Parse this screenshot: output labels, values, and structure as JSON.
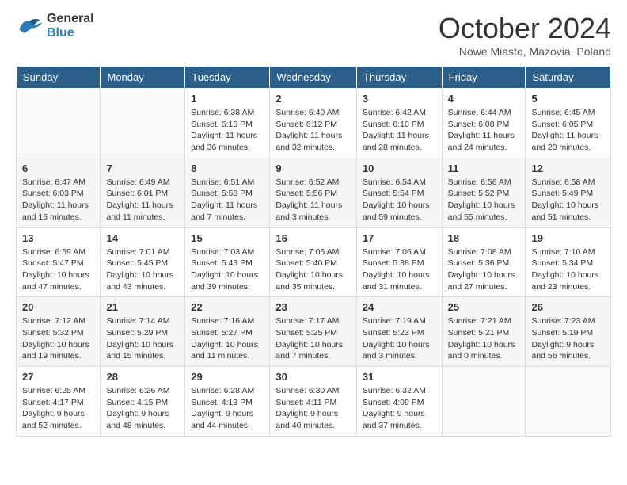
{
  "header": {
    "logo_general": "General",
    "logo_blue": "Blue",
    "month_title": "October 2024",
    "location": "Nowe Miasto, Mazovia, Poland"
  },
  "days_of_week": [
    "Sunday",
    "Monday",
    "Tuesday",
    "Wednesday",
    "Thursday",
    "Friday",
    "Saturday"
  ],
  "weeks": [
    {
      "days": [
        {
          "num": "",
          "info": ""
        },
        {
          "num": "",
          "info": ""
        },
        {
          "num": "1",
          "info": "Sunrise: 6:38 AM\nSunset: 6:15 PM\nDaylight: 11 hours and 36 minutes."
        },
        {
          "num": "2",
          "info": "Sunrise: 6:40 AM\nSunset: 6:12 PM\nDaylight: 11 hours and 32 minutes."
        },
        {
          "num": "3",
          "info": "Sunrise: 6:42 AM\nSunset: 6:10 PM\nDaylight: 11 hours and 28 minutes."
        },
        {
          "num": "4",
          "info": "Sunrise: 6:44 AM\nSunset: 6:08 PM\nDaylight: 11 hours and 24 minutes."
        },
        {
          "num": "5",
          "info": "Sunrise: 6:45 AM\nSunset: 6:05 PM\nDaylight: 11 hours and 20 minutes."
        }
      ]
    },
    {
      "days": [
        {
          "num": "6",
          "info": "Sunrise: 6:47 AM\nSunset: 6:03 PM\nDaylight: 11 hours and 16 minutes."
        },
        {
          "num": "7",
          "info": "Sunrise: 6:49 AM\nSunset: 6:01 PM\nDaylight: 11 hours and 11 minutes."
        },
        {
          "num": "8",
          "info": "Sunrise: 6:51 AM\nSunset: 5:58 PM\nDaylight: 11 hours and 7 minutes."
        },
        {
          "num": "9",
          "info": "Sunrise: 6:52 AM\nSunset: 5:56 PM\nDaylight: 11 hours and 3 minutes."
        },
        {
          "num": "10",
          "info": "Sunrise: 6:54 AM\nSunset: 5:54 PM\nDaylight: 10 hours and 59 minutes."
        },
        {
          "num": "11",
          "info": "Sunrise: 6:56 AM\nSunset: 5:52 PM\nDaylight: 10 hours and 55 minutes."
        },
        {
          "num": "12",
          "info": "Sunrise: 6:58 AM\nSunset: 5:49 PM\nDaylight: 10 hours and 51 minutes."
        }
      ]
    },
    {
      "days": [
        {
          "num": "13",
          "info": "Sunrise: 6:59 AM\nSunset: 5:47 PM\nDaylight: 10 hours and 47 minutes."
        },
        {
          "num": "14",
          "info": "Sunrise: 7:01 AM\nSunset: 5:45 PM\nDaylight: 10 hours and 43 minutes."
        },
        {
          "num": "15",
          "info": "Sunrise: 7:03 AM\nSunset: 5:43 PM\nDaylight: 10 hours and 39 minutes."
        },
        {
          "num": "16",
          "info": "Sunrise: 7:05 AM\nSunset: 5:40 PM\nDaylight: 10 hours and 35 minutes."
        },
        {
          "num": "17",
          "info": "Sunrise: 7:06 AM\nSunset: 5:38 PM\nDaylight: 10 hours and 31 minutes."
        },
        {
          "num": "18",
          "info": "Sunrise: 7:08 AM\nSunset: 5:36 PM\nDaylight: 10 hours and 27 minutes."
        },
        {
          "num": "19",
          "info": "Sunrise: 7:10 AM\nSunset: 5:34 PM\nDaylight: 10 hours and 23 minutes."
        }
      ]
    },
    {
      "days": [
        {
          "num": "20",
          "info": "Sunrise: 7:12 AM\nSunset: 5:32 PM\nDaylight: 10 hours and 19 minutes."
        },
        {
          "num": "21",
          "info": "Sunrise: 7:14 AM\nSunset: 5:29 PM\nDaylight: 10 hours and 15 minutes."
        },
        {
          "num": "22",
          "info": "Sunrise: 7:16 AM\nSunset: 5:27 PM\nDaylight: 10 hours and 11 minutes."
        },
        {
          "num": "23",
          "info": "Sunrise: 7:17 AM\nSunset: 5:25 PM\nDaylight: 10 hours and 7 minutes."
        },
        {
          "num": "24",
          "info": "Sunrise: 7:19 AM\nSunset: 5:23 PM\nDaylight: 10 hours and 3 minutes."
        },
        {
          "num": "25",
          "info": "Sunrise: 7:21 AM\nSunset: 5:21 PM\nDaylight: 10 hours and 0 minutes."
        },
        {
          "num": "26",
          "info": "Sunrise: 7:23 AM\nSunset: 5:19 PM\nDaylight: 9 hours and 56 minutes."
        }
      ]
    },
    {
      "days": [
        {
          "num": "27",
          "info": "Sunrise: 6:25 AM\nSunset: 4:17 PM\nDaylight: 9 hours and 52 minutes."
        },
        {
          "num": "28",
          "info": "Sunrise: 6:26 AM\nSunset: 4:15 PM\nDaylight: 9 hours and 48 minutes."
        },
        {
          "num": "29",
          "info": "Sunrise: 6:28 AM\nSunset: 4:13 PM\nDaylight: 9 hours and 44 minutes."
        },
        {
          "num": "30",
          "info": "Sunrise: 6:30 AM\nSunset: 4:11 PM\nDaylight: 9 hours and 40 minutes."
        },
        {
          "num": "31",
          "info": "Sunrise: 6:32 AM\nSunset: 4:09 PM\nDaylight: 9 hours and 37 minutes."
        },
        {
          "num": "",
          "info": ""
        },
        {
          "num": "",
          "info": ""
        }
      ]
    }
  ]
}
